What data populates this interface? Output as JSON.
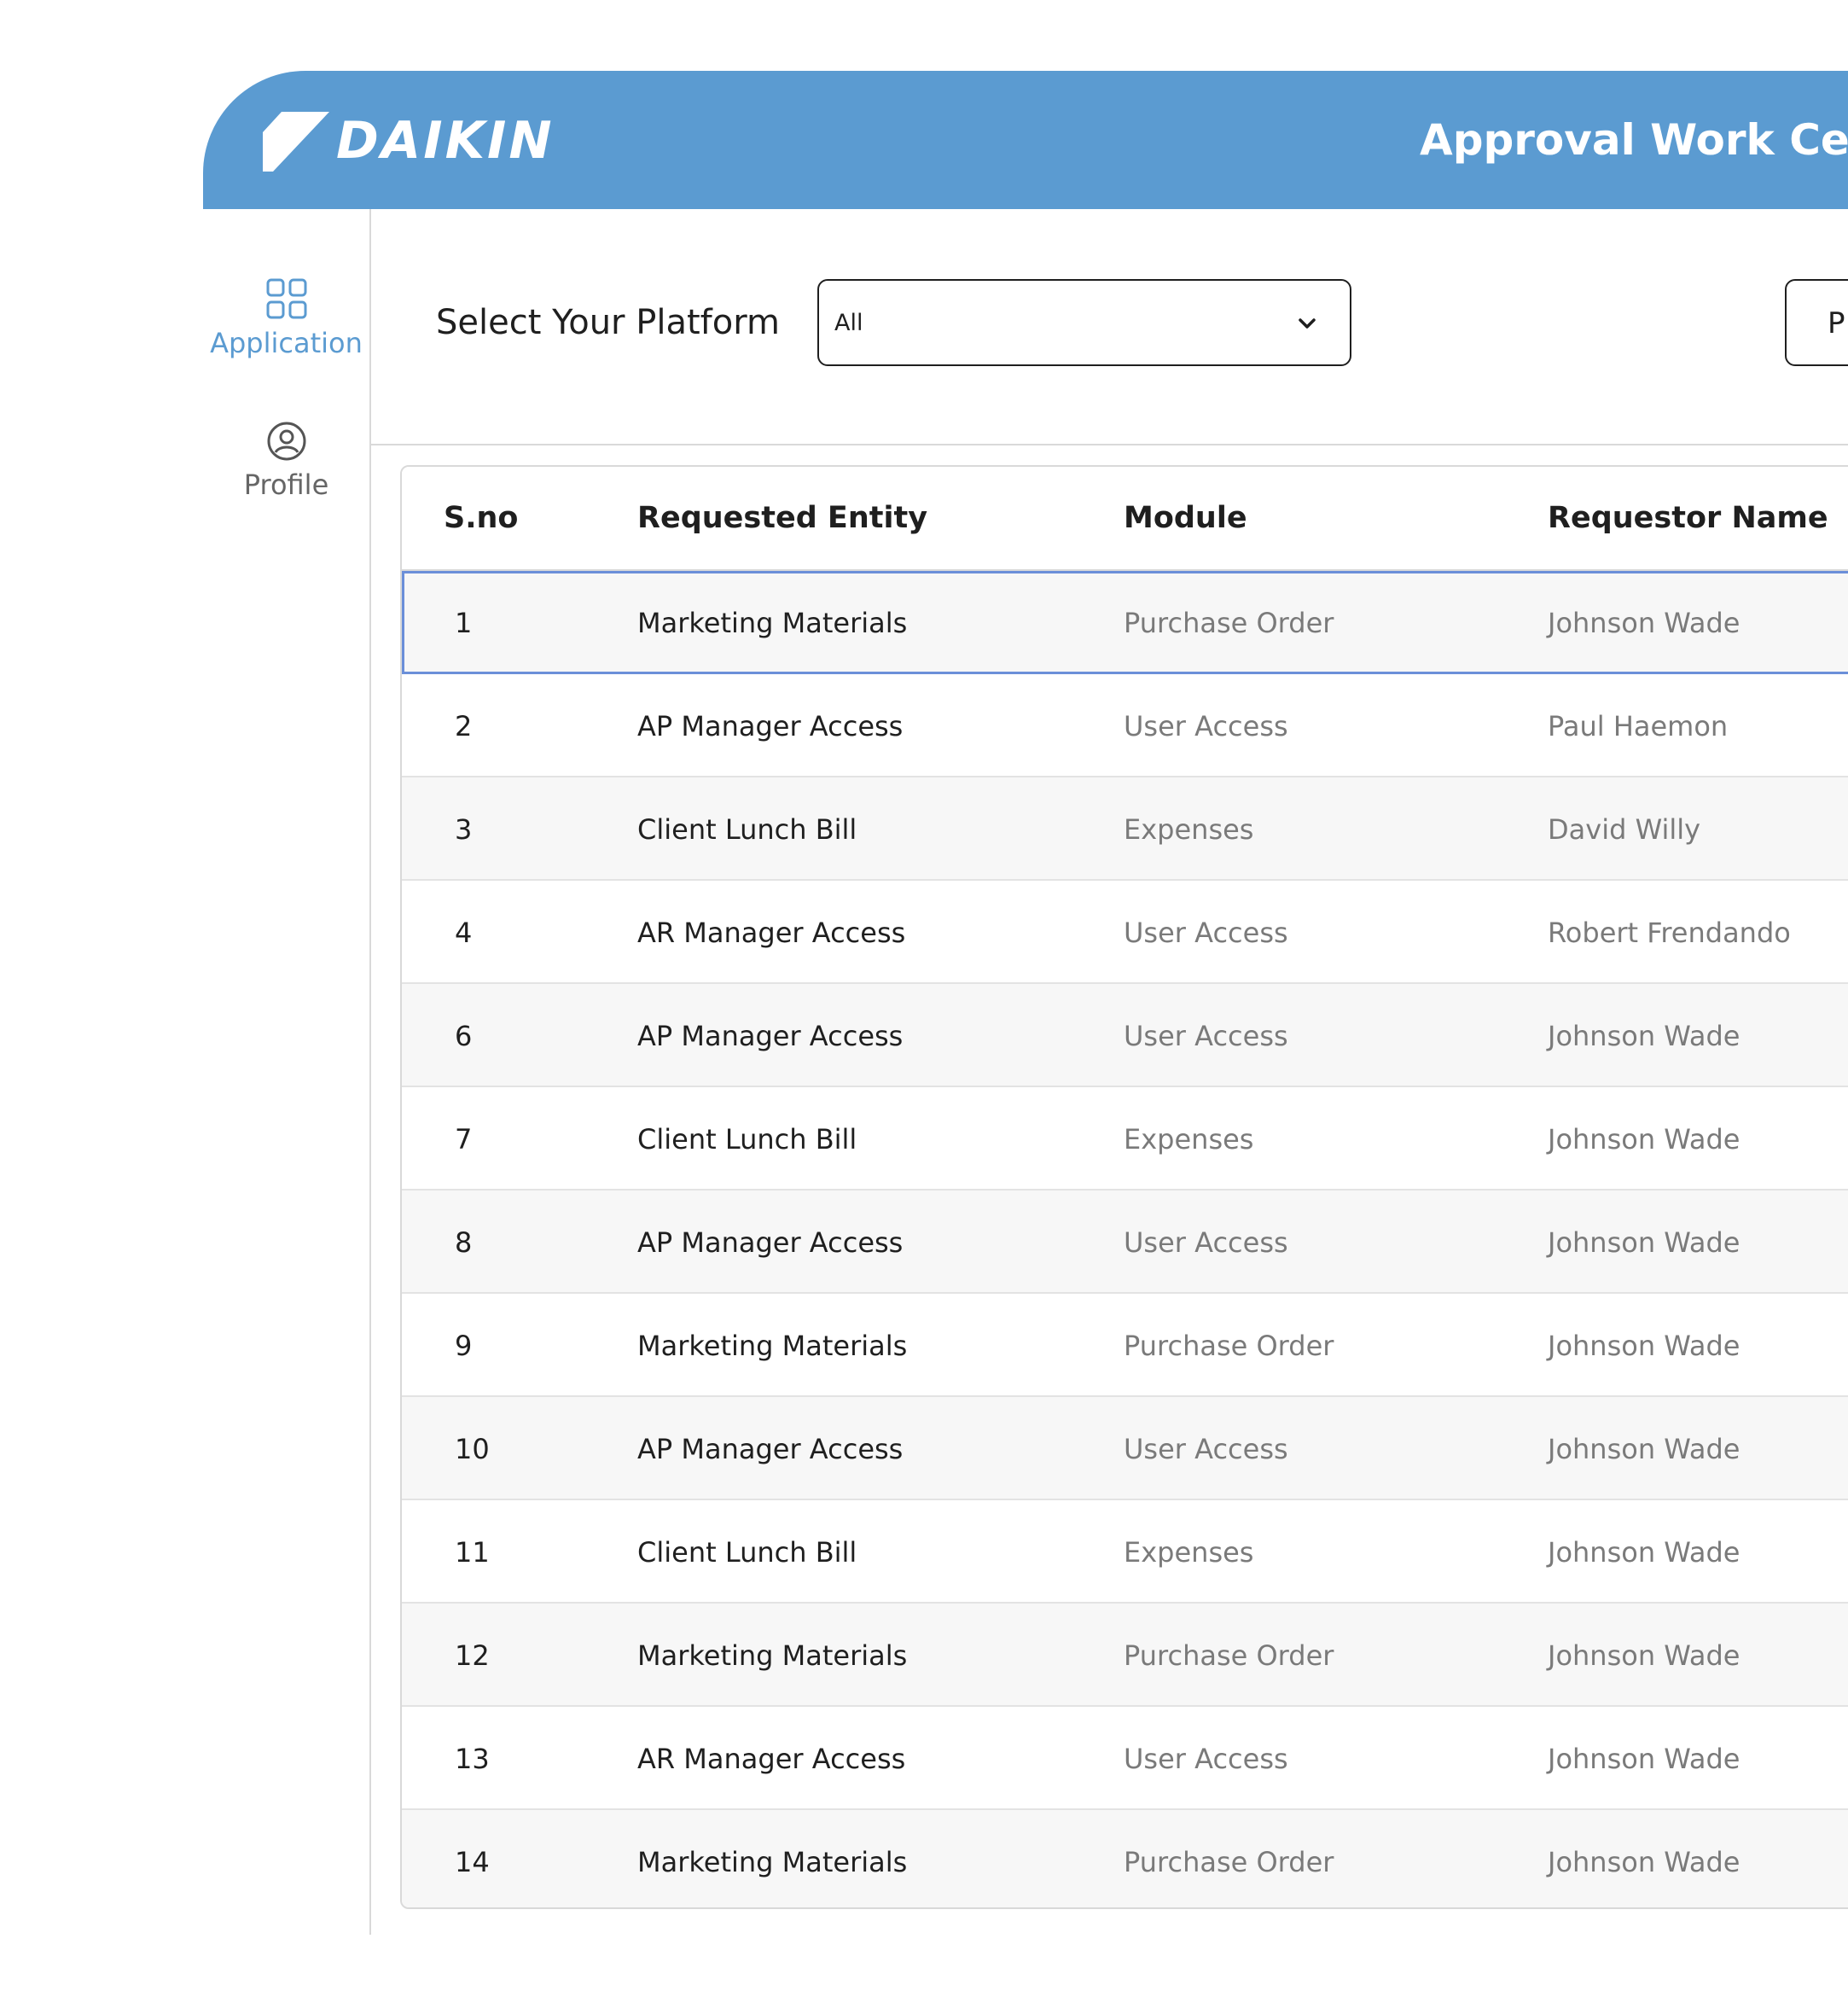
{
  "header": {
    "brand": "DAIKIN",
    "title": "Approval Work Cente",
    "brand_color": "#5b9bd1"
  },
  "sidebar": {
    "items": [
      {
        "label": "Application",
        "icon": "grid-icon",
        "active": true
      },
      {
        "label": "Profile",
        "icon": "user-circle-icon",
        "active": false
      }
    ]
  },
  "filter": {
    "label": "Select Your Platform",
    "select_value": "All",
    "right_button_label": "P"
  },
  "table": {
    "columns": [
      "S.no",
      "Requested Entity",
      "Module",
      "Requestor Name"
    ],
    "rows": [
      {
        "sno": "1",
        "entity": "Marketing Materials",
        "module": "Purchase Order",
        "requestor": "Johnson Wade"
      },
      {
        "sno": "2",
        "entity": "AP Manager Access",
        "module": "User Access",
        "requestor": "Paul Haemon"
      },
      {
        "sno": "3",
        "entity": "Client Lunch Bill",
        "module": "Expenses",
        "requestor": "David Willy"
      },
      {
        "sno": "4",
        "entity": "AR Manager Access",
        "module": "User Access",
        "requestor": "Robert Frendando"
      },
      {
        "sno": "6",
        "entity": "AP Manager Access",
        "module": "User Access",
        "requestor": "Johnson Wade"
      },
      {
        "sno": "7",
        "entity": "Client Lunch Bill",
        "module": "Expenses",
        "requestor": "Johnson Wade"
      },
      {
        "sno": "8",
        "entity": "AP Manager Access",
        "module": "User Access",
        "requestor": "Johnson Wade"
      },
      {
        "sno": "9",
        "entity": "Marketing Materials",
        "module": "Purchase Order",
        "requestor": "Johnson Wade"
      },
      {
        "sno": "10",
        "entity": "AP Manager Access",
        "module": "User Access",
        "requestor": "Johnson Wade"
      },
      {
        "sno": "11",
        "entity": "Client Lunch Bill",
        "module": "Expenses",
        "requestor": "Johnson Wade"
      },
      {
        "sno": "12",
        "entity": "Marketing Materials",
        "module": "Purchase Order",
        "requestor": "Johnson Wade"
      },
      {
        "sno": "13",
        "entity": "AR Manager Access",
        "module": "User Access",
        "requestor": "Johnson Wade"
      },
      {
        "sno": "14",
        "entity": "Marketing Materials",
        "module": "Purchase Order",
        "requestor": "Johnson Wade"
      }
    ]
  }
}
